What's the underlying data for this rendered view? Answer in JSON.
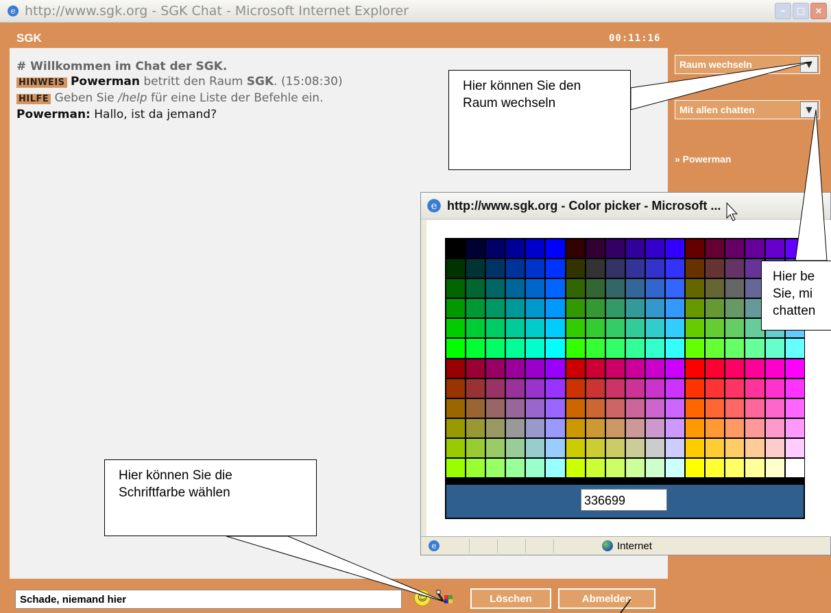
{
  "browser": {
    "title": "http://www.sgk.org - SGK Chat - Microsoft Internet Explorer"
  },
  "app": {
    "name": "SGK",
    "clock": "00:11:16"
  },
  "chat": {
    "welcome": "# Willkommen im Chat der SGK.",
    "msg1_badge": "HINWEIS",
    "msg1_user": "Powerman",
    "msg1_text_a": " betritt den Raum ",
    "msg1_room": "SGK",
    "msg1_text_b": ". (15:08:30)",
    "msg2_badge": "HILFE",
    "msg2_text_a": " Geben Sie ",
    "msg2_cmd": "/help",
    "msg2_text_b": " für eine Liste der Befehle ein.",
    "msg3_user": "Powerman:",
    "msg3_text": " Hallo, ist da jemand?"
  },
  "sidebar": {
    "room_select": "Raum wechseln",
    "chat_target_select": "Mit allen chatten",
    "user": "» Powerman"
  },
  "callouts": {
    "room": "Hier können Sie den Raum wechseln",
    "target": "Hier be Sie, mi chatten",
    "color": "Hier können Sie die Schriftfarbe wählen"
  },
  "color_picker": {
    "title": "http://www.sgk.org - Color picker - Microsoft ...",
    "value": "336699",
    "status_zone": "Internet"
  },
  "footer": {
    "message_input_value": "Schade, niemand hier",
    "clear_button": "Löschen",
    "logout_button": "Abmelden"
  },
  "icons": [
    "ie-icon",
    "minimize-icon",
    "maximize-icon",
    "close-icon",
    "chevron-down-icon",
    "smiley-icon",
    "font-color-icon",
    "globe-icon"
  ],
  "colors": {
    "chrome_orange": "#d98f56",
    "button_orange": "#e0a067",
    "chat_bg": "#f1f1f1",
    "hex_bar": "#2f5f8f"
  }
}
